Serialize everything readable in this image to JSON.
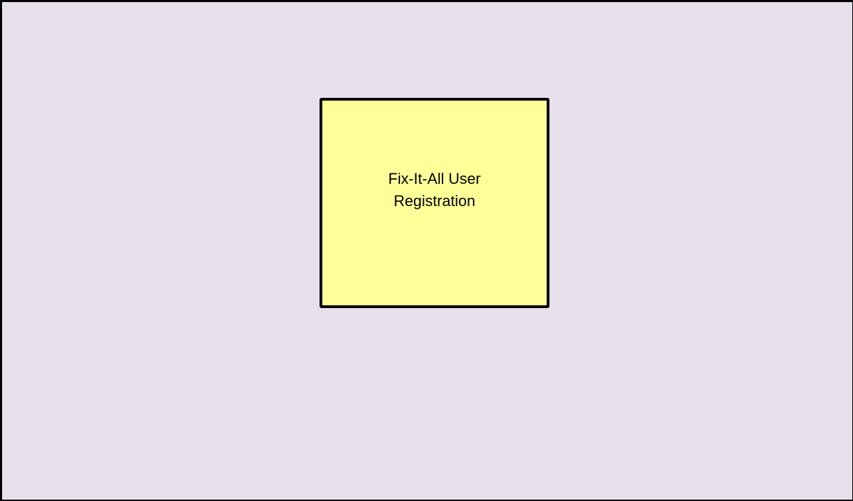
{
  "diagram": {
    "box": {
      "lines": [
        "Fix-It-All User",
        "Registration"
      ]
    }
  },
  "colors": {
    "background": "#E7E0EC",
    "box_fill": "#FFFF99",
    "border": "#000000",
    "text": "#000000"
  }
}
